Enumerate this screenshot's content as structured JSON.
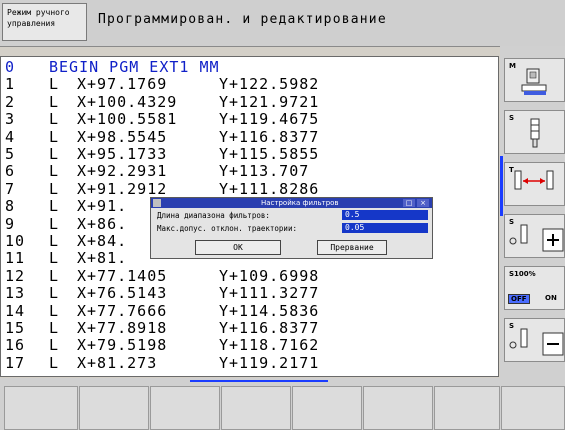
{
  "header": {
    "mode_line1": "Режим ручного",
    "mode_line2": "управления",
    "title": "Программирован. и редактирование"
  },
  "program": [
    {
      "num": "0",
      "cmd": "BEGIN PGM EXT1 MM",
      "x": "",
      "y": ""
    },
    {
      "num": "1",
      "cmd": "L",
      "x": "X+97.1769",
      "y": "Y+122.5982"
    },
    {
      "num": "2",
      "cmd": "L",
      "x": "X+100.4329",
      "y": "Y+121.9721"
    },
    {
      "num": "3",
      "cmd": "L",
      "x": "X+100.5581",
      "y": "Y+119.4675"
    },
    {
      "num": "4",
      "cmd": "L",
      "x": "X+98.5545",
      "y": "Y+116.8377"
    },
    {
      "num": "5",
      "cmd": "L",
      "x": "X+95.1733",
      "y": "Y+115.5855"
    },
    {
      "num": "6",
      "cmd": "L",
      "x": "X+92.2931",
      "y": "Y+113.707"
    },
    {
      "num": "7",
      "cmd": "L",
      "x": "X+91.2912",
      "y": "Y+111.8286"
    },
    {
      "num": "8",
      "cmd": "L",
      "x": "X+91.",
      "y": ""
    },
    {
      "num": "9",
      "cmd": "L",
      "x": "X+86.",
      "y": ""
    },
    {
      "num": "10",
      "cmd": "L",
      "x": "X+84.",
      "y": ""
    },
    {
      "num": "11",
      "cmd": "L",
      "x": "X+81.",
      "y": ""
    },
    {
      "num": "12",
      "cmd": "L",
      "x": "X+77.1405",
      "y": "Y+109.6998"
    },
    {
      "num": "13",
      "cmd": "L",
      "x": "X+76.5143",
      "y": "Y+111.3277"
    },
    {
      "num": "14",
      "cmd": "L",
      "x": "X+77.7666",
      "y": "Y+114.5836"
    },
    {
      "num": "15",
      "cmd": "L",
      "x": "X+77.8918",
      "y": "Y+116.8377"
    },
    {
      "num": "16",
      "cmd": "L",
      "x": "X+79.5198",
      "y": "Y+118.7162"
    },
    {
      "num": "17",
      "cmd": "L",
      "x": "X+81.273",
      "y": "Y+119.2171"
    }
  ],
  "dialog": {
    "title": "Настройка фильтров",
    "window_buttons": [
      "□",
      "×"
    ],
    "field1_label": "Длина диапазона фильтров:",
    "field1_value": "0.5",
    "field2_label": "Макс.допус. отклон. траектории:",
    "field2_value": "0.05",
    "ok_label": "OK",
    "cancel_label": "Прервание"
  },
  "softkeys": {
    "m_label": "M",
    "s_label": "S",
    "t_label": "T",
    "s_plus_label": "S",
    "override_label": "S100%",
    "off_label": "OFF",
    "on_label": "ON",
    "s_minus_label": "S"
  },
  "colors": {
    "accent": "#1a3cff",
    "dialog_title": "#2a3fb0",
    "field_bg": "#1537c8",
    "first_line": "#1020c8"
  }
}
